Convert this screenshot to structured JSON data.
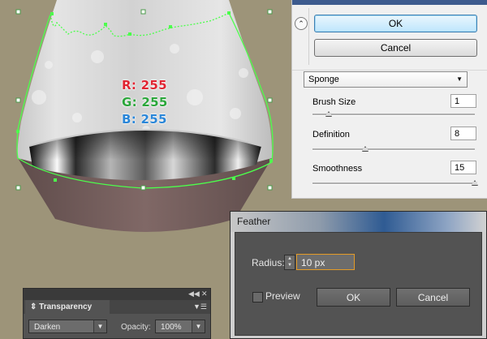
{
  "readout": {
    "r": "R: 255",
    "g": "G: 255",
    "b": "B: 255"
  },
  "sponge_panel": {
    "ok_label": "OK",
    "cancel_label": "Cancel",
    "filter_selected": "Sponge",
    "params": [
      {
        "label": "Brush Size",
        "value": "1",
        "slider_fraction": 0.1
      },
      {
        "label": "Definition",
        "value": "8",
        "slider_fraction": 0.32
      },
      {
        "label": "Smoothness",
        "value": "15",
        "slider_fraction": 1.0
      }
    ]
  },
  "feather_dialog": {
    "title": "Feather",
    "radius_label": "Radius:",
    "radius_value": "10 px",
    "preview_label": "Preview",
    "preview_checked": false,
    "ok_label": "OK",
    "cancel_label": "Cancel"
  },
  "transparency_panel": {
    "tab_label": "Transparency",
    "blend_mode": "Darken",
    "opacity_label": "Opacity:",
    "opacity_value": "100%"
  },
  "colors": {
    "canvas_bg": "#9d9479",
    "selection_path": "#4cff4c",
    "accent_focus": "#e39b27",
    "dialog_title_blue": "#2f5b93"
  }
}
